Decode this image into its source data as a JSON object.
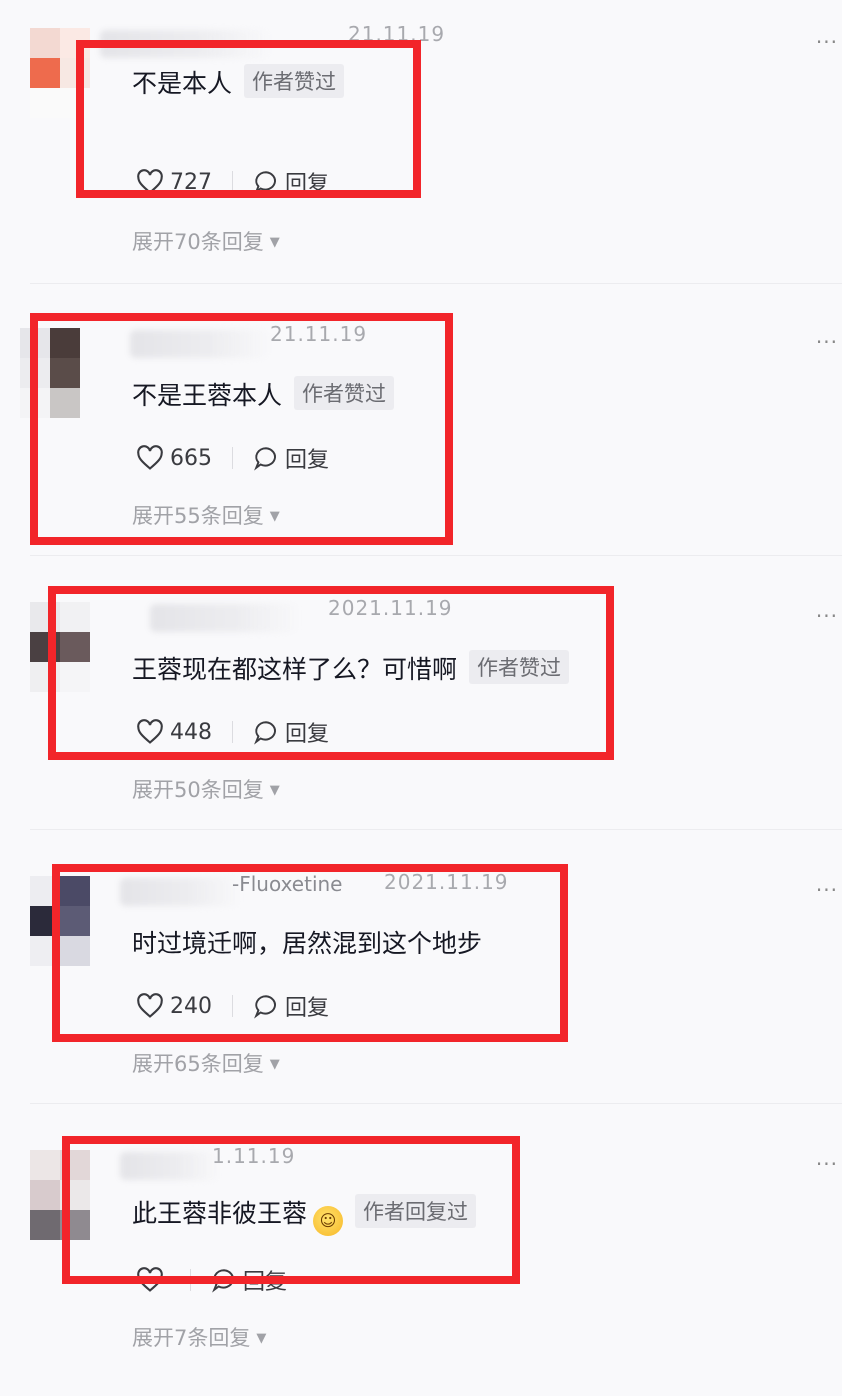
{
  "colors": {
    "highlight": "#f2252a",
    "background": "#f9f9fb",
    "text": "#161823",
    "muted": "#a1a2a7"
  },
  "comments": [
    {
      "name": "",
      "date": "21.11.19",
      "text": "不是本人",
      "badge": "作者赞过",
      "likes": "727",
      "reply_label": "回复",
      "expand": "展开70条回复"
    },
    {
      "name": "",
      "date": "21.11.19",
      "text": "不是王蓉本人",
      "badge": "作者赞过",
      "likes": "665",
      "reply_label": "回复",
      "expand": "展开55条回复"
    },
    {
      "name": "",
      "date": "2021.11.19",
      "text": "王蓉现在都这样了么？可惜啊",
      "badge": "作者赞过",
      "likes": "448",
      "reply_label": "回复",
      "expand": "展开50条回复"
    },
    {
      "name": "-Fluoxetine",
      "date": "2021.11.19",
      "text": "时过境迁啊，居然混到这个地步",
      "badge": "",
      "likes": "240",
      "reply_label": "回复",
      "expand": "展开65条回复"
    },
    {
      "name": "",
      "date": "1.11.19",
      "text": "此王蓉非彼王蓉",
      "badge": "作者回复过",
      "likes": "",
      "reply_label": "回复",
      "expand": "展开7条回复"
    }
  ],
  "icons": {
    "like": "heart-icon",
    "reply": "comment-bubble-icon",
    "more": "more-icon",
    "expand": "caret-down-icon",
    "emoji": "laughing-tears-emoji"
  },
  "more_label": "···"
}
